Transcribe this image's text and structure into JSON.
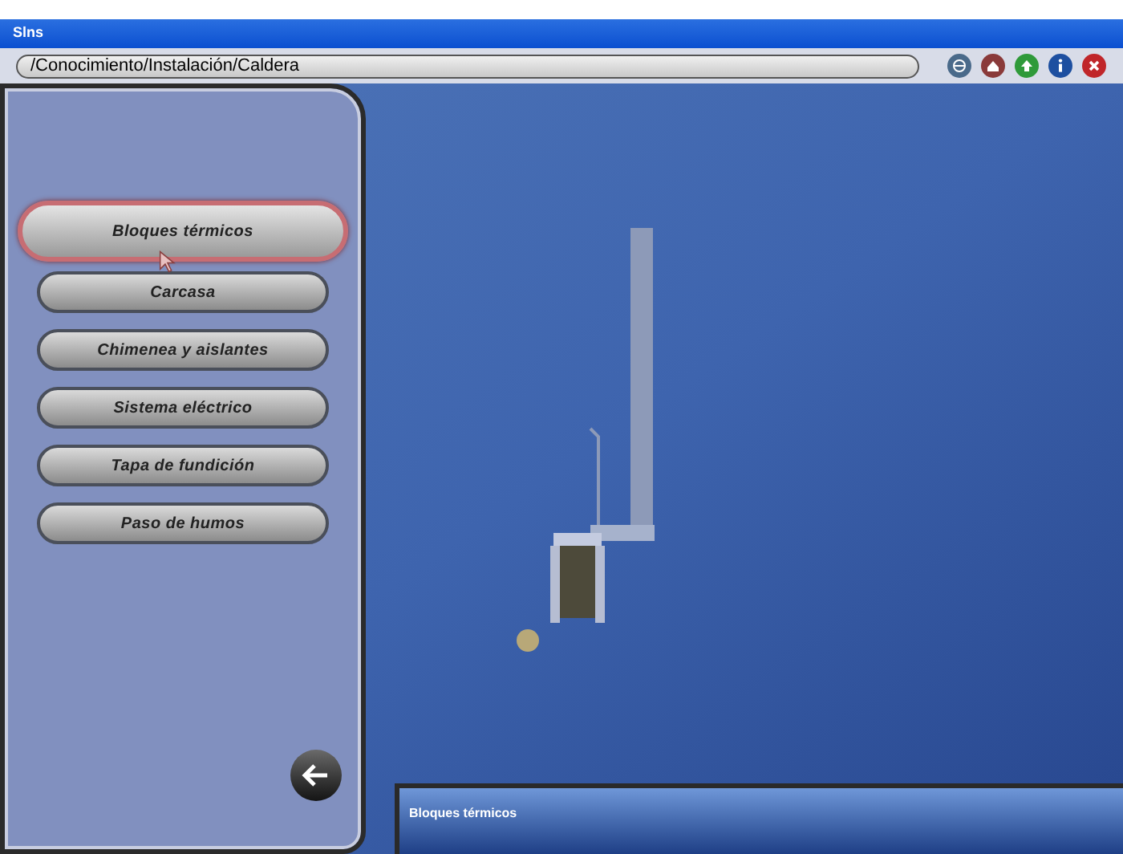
{
  "window": {
    "title": "Slns"
  },
  "address": {
    "path": "/Conocimiento/Instalación/Caldera"
  },
  "toolbar": [
    {
      "kind": "globe"
    },
    {
      "kind": "home"
    },
    {
      "kind": "up"
    },
    {
      "kind": "info"
    },
    {
      "kind": "close"
    }
  ],
  "menu": [
    {
      "label": "Bloques térmicos",
      "selected": true
    },
    {
      "label": "Carcasa",
      "selected": false
    },
    {
      "label": "Chimenea y aislantes",
      "selected": false
    },
    {
      "label": "Sistema eléctrico",
      "selected": false
    },
    {
      "label": "Tapa de fundición",
      "selected": false
    },
    {
      "label": "Paso de humos",
      "selected": false
    }
  ],
  "info_panel": {
    "title": "Bloques térmicos"
  }
}
